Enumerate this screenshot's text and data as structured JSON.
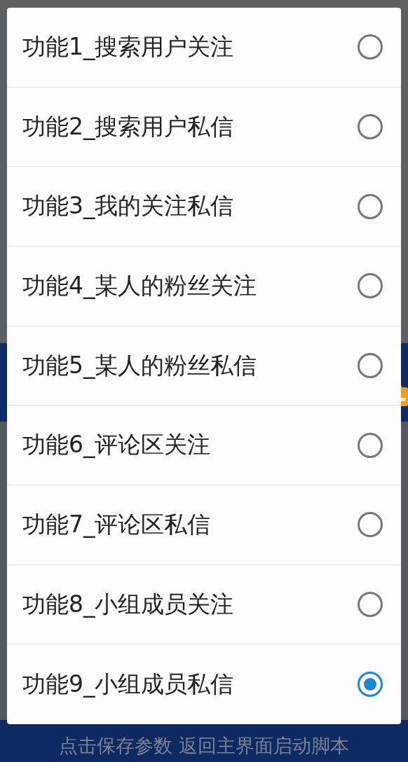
{
  "dialog": {
    "options": [
      {
        "label": "功能1_搜索用户关注",
        "selected": false
      },
      {
        "label": "功能2_搜索用户私信",
        "selected": false
      },
      {
        "label": "功能3_我的关注私信",
        "selected": false
      },
      {
        "label": "功能4_某人的粉丝关注",
        "selected": false
      },
      {
        "label": "功能5_某人的粉丝私信",
        "selected": false
      },
      {
        "label": "功能6_评论区关注",
        "selected": false
      },
      {
        "label": "功能7_评论区私信",
        "selected": false
      },
      {
        "label": "功能8_小组成员关注",
        "selected": false
      },
      {
        "label": "功能9_小组成员私信",
        "selected": true
      }
    ]
  },
  "bottom_bar": {
    "label": "点击保存参数 返回主界面启动脚本"
  }
}
